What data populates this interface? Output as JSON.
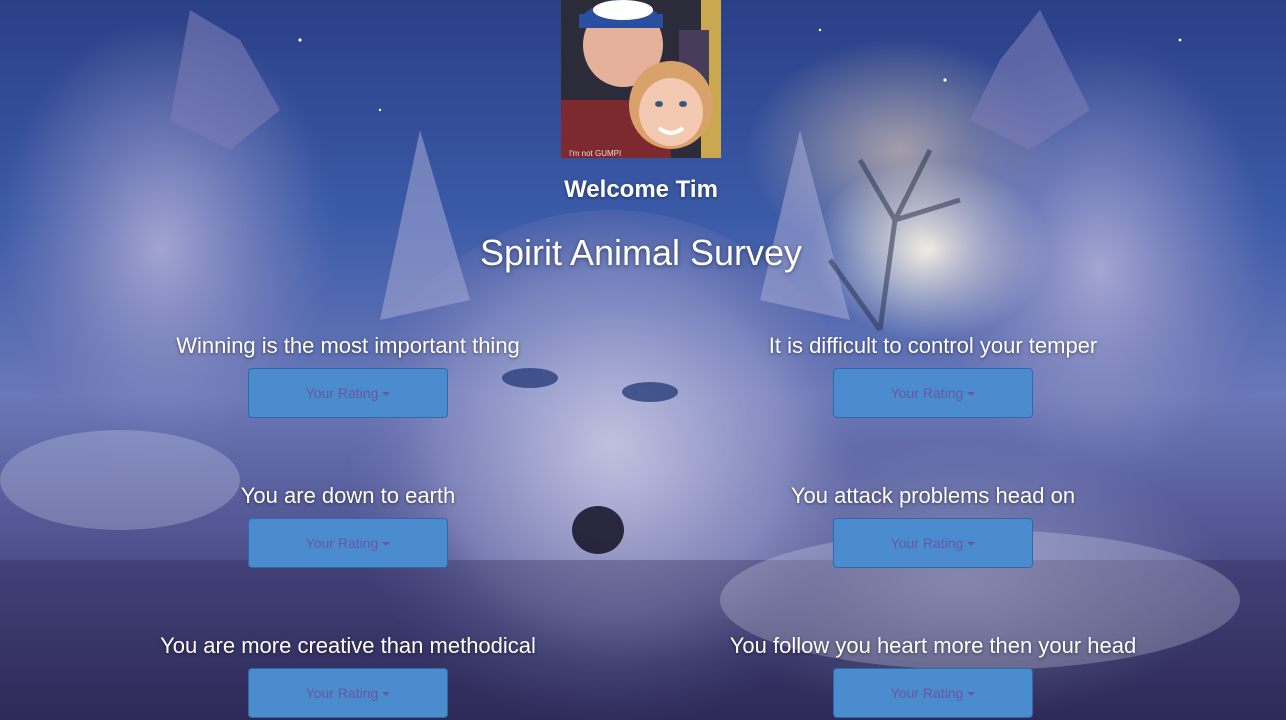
{
  "header": {
    "welcome": "Welcome Tim",
    "title": "Spirit Animal Survey",
    "avatar_shirt_text": "I'm not GUMPI"
  },
  "questions": [
    {
      "text": "Winning is the most important thing",
      "button_label": "Your Rating"
    },
    {
      "text": "It is difficult to control your temper",
      "button_label": "Your Rating"
    },
    {
      "text": "You are down to earth",
      "button_label": "Your Rating"
    },
    {
      "text": "You attack problems head on",
      "button_label": "Your Rating"
    },
    {
      "text": "You are more creative than methodical",
      "button_label": "Your Rating"
    },
    {
      "text": "You follow you heart more then your head",
      "button_label": "Your Rating"
    }
  ],
  "colors": {
    "button_bg": "#4a8ccd",
    "button_text": "#6a56a6",
    "heading_text": "#ffffff"
  },
  "icons": {
    "dropdown": "caret-down-icon"
  }
}
